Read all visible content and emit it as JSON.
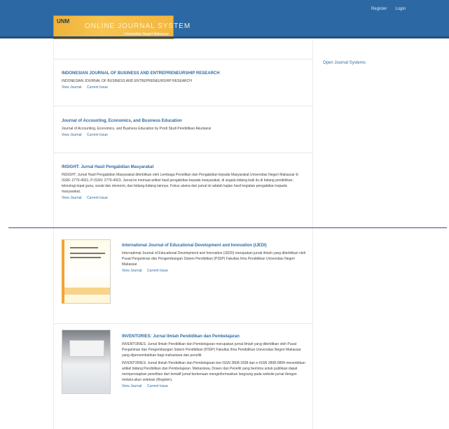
{
  "header": {
    "logo_badge": "UNM",
    "logo_title": "ONLINE JOURNAL SYSTEM",
    "logo_subtitle": "Universitas Negeri Makassar",
    "links": [
      "Register",
      "Login"
    ],
    "colors": {
      "bar": "#2c69a4",
      "logo": "#f6c451"
    }
  },
  "sidebar": {
    "link": "Open Journal Systems"
  },
  "journals": [
    {
      "title": "INDONESIAN JOURNAL OF BUSINESS AND ENTREPRENEURSHIP RESEARCH",
      "desc": "INDONESIAN JOURNAL OF BUSINESS AND ENTREPRENEURSHIP RESEARCH",
      "view": "View Journal",
      "current": "Current Issue"
    },
    {
      "title": "Journal of Accounting, Economics, and Business Education",
      "desc": "Journal of Accounting, Economics, and Business Education by Prodi Studi Pendidikan Akuntansi",
      "view": "View Journal",
      "current": "Current Issue"
    },
    {
      "title": "INSIGHT: Jurnal Hasil Pengabdian Masyarakat",
      "desc": "INSIGHT: Jurnal Hasil Pengabdian Masyarakat diterbitkan oleh Lembaga Penelitian dan Pengabdian kepada Masyarakat Universitas Negeri Makassar E-ISSN: 2776-4931, P-ISSN: 2776-4923. Jurnal ini memuat artikel hasil pengabdian kepada masyarakat, di segala bidang baik itu di bidang pendidikan, teknologi tepat guna, sosial dan ekonomi, dan bidang-bidang lainnya. Fokus utama dari jurnal ini adalah kajian hasil kegiatan pengabdian kepada masyarakat.",
      "view": "View Journal",
      "current": "Current Issue"
    },
    {
      "title": "International Journal of Educational Development and Innovation (IJEDI)",
      "desc": "International Journal of Educational Development and Innovation (IJEDI) merupakan jurnal ilmiah yang diterbitkan oleh Pusat Penjaminan dan Pengembangan Sistem Pendidikan (P3SP) Fakultas Ilmu Pendidikan Universitas Negeri Makassar",
      "view": "View Journal",
      "current": "Current Issue"
    },
    {
      "title": "INVENTORIES: Jurnal Ilmiah Pendidikan dan Pembelajaran",
      "desc": "INVENTORIES: Jurnal Ilmiah Pendidikan dan Pembelajaran merupakan jurnal ilmiah yang diterbitkan oleh Pusat Penjaminan dan Pengembangan Sistem Pendidikan (P3SP) Fakultas Ilmu Pendidikan Universitas Negeri Makassar yang dipersembahkan bagi mahasiswa dan peneliti.",
      "desc2": "INVENTORIES: Jurnal Ilmiah Pendidikan dan Pembelajaran ber-ISSN 2808-1838 dan e-ISSN 2808-0899 menerbitkan artikel bidang Pendidikan dan Pembelajaran. Mahasiswa, Dosen dan Peneliti yang bermina untuk publikasi dapat mempersiapkan penelitian dari tentatif jurnal berkenaan menginformasikan langsung pada website jurnal dengan melalui akun selekasi (Register).",
      "view": "View Journal",
      "current": "Current Issue"
    }
  ]
}
